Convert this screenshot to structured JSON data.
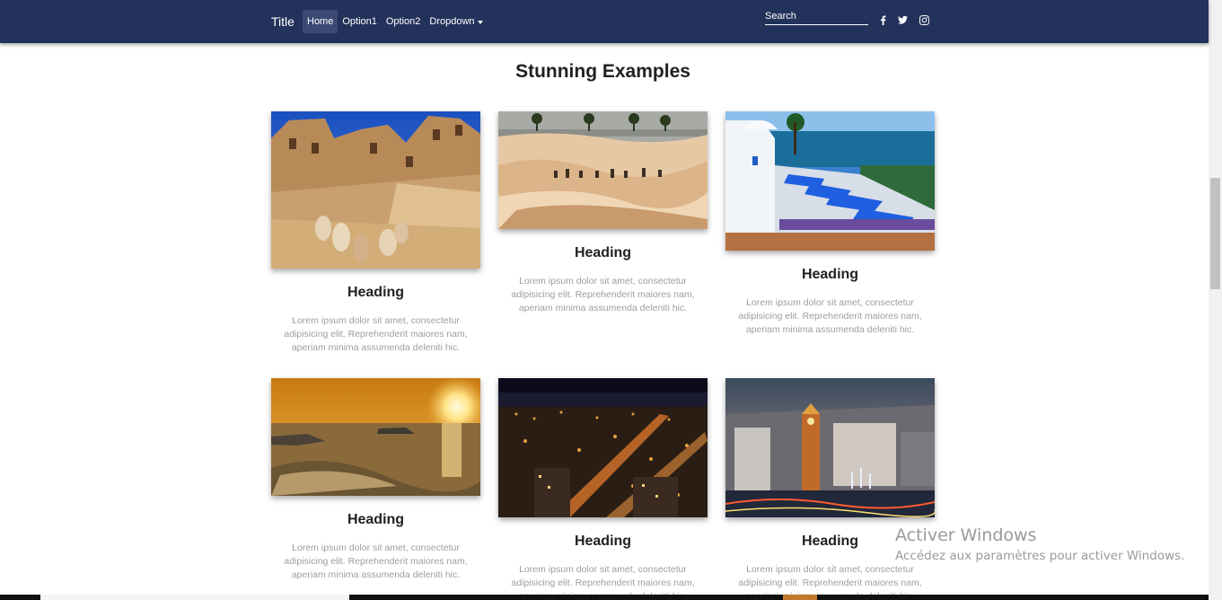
{
  "navbar": {
    "brand": "Title",
    "items": [
      {
        "label": "Home",
        "active": true
      },
      {
        "label": "Option1",
        "active": false
      },
      {
        "label": "Option2",
        "active": false
      },
      {
        "label": "Dropdown",
        "active": false
      }
    ],
    "search_placeholder": "Search",
    "social_icons": [
      "facebook-icon",
      "twitter-icon",
      "instagram-icon"
    ],
    "background_color": "#23325a"
  },
  "main": {
    "title": "Stunning Examples",
    "cards": [
      {
        "heading": "Heading",
        "text": "Lorem ipsum dolor sit amet, consectetur adipisicing elit. Reprehenderit maiores nam, aperiam minima assumenda deleniti hic.",
        "image": "desert-village-photo"
      },
      {
        "heading": "Heading",
        "text": "Lorem ipsum dolor sit amet, consectetur adipisicing elit. Reprehenderit maiores nam, aperiam minima assumenda deleniti hic.",
        "image": "desert-caravan-photo"
      },
      {
        "heading": "Heading",
        "text": "Lorem ipsum dolor sit amet, consectetur adipisicing elit. Reprehenderit maiores nam, aperiam minima assumenda deleniti hic.",
        "image": "seaside-cafe-photo"
      },
      {
        "heading": "Heading",
        "text": "Lorem ipsum dolor sit amet, consectetur adipisicing elit. Reprehenderit maiores nam, aperiam minima assumenda deleniti hic.",
        "image": "sunset-sea-photo"
      },
      {
        "heading": "Heading",
        "text": "Lorem ipsum dolor sit amet, consectetur adipisicing elit. Reprehenderit maiores nam, aperiam minima assumenda deleniti hic.",
        "image": "city-night-photo"
      },
      {
        "heading": "Heading",
        "text": "Lorem ipsum dolor sit amet, consectetur adipisicing elit. Reprehenderit maiores nam, aperiam minima assumenda deleniti hic.",
        "image": "city-clock-tower-photo"
      }
    ]
  },
  "watermark": {
    "line1": "Activer Windows",
    "line2": "Accédez aux paramètres pour activer Windows."
  }
}
